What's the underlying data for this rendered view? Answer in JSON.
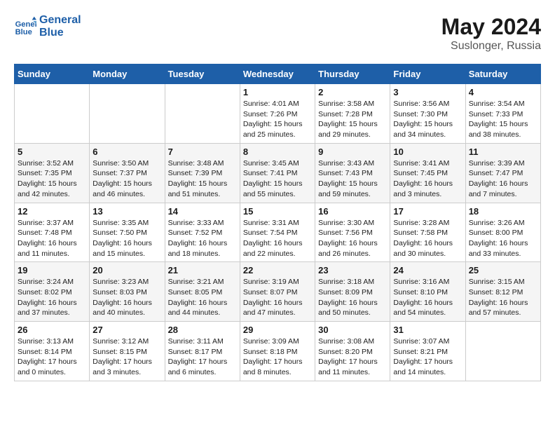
{
  "header": {
    "logo_line1": "General",
    "logo_line2": "Blue",
    "month": "May 2024",
    "location": "Suslonger, Russia"
  },
  "days_of_week": [
    "Sunday",
    "Monday",
    "Tuesday",
    "Wednesday",
    "Thursday",
    "Friday",
    "Saturday"
  ],
  "weeks": [
    [
      {
        "day": "",
        "info": ""
      },
      {
        "day": "",
        "info": ""
      },
      {
        "day": "",
        "info": ""
      },
      {
        "day": "1",
        "info": "Sunrise: 4:01 AM\nSunset: 7:26 PM\nDaylight: 15 hours\nand 25 minutes."
      },
      {
        "day": "2",
        "info": "Sunrise: 3:58 AM\nSunset: 7:28 PM\nDaylight: 15 hours\nand 29 minutes."
      },
      {
        "day": "3",
        "info": "Sunrise: 3:56 AM\nSunset: 7:30 PM\nDaylight: 15 hours\nand 34 minutes."
      },
      {
        "day": "4",
        "info": "Sunrise: 3:54 AM\nSunset: 7:33 PM\nDaylight: 15 hours\nand 38 minutes."
      }
    ],
    [
      {
        "day": "5",
        "info": "Sunrise: 3:52 AM\nSunset: 7:35 PM\nDaylight: 15 hours\nand 42 minutes."
      },
      {
        "day": "6",
        "info": "Sunrise: 3:50 AM\nSunset: 7:37 PM\nDaylight: 15 hours\nand 46 minutes."
      },
      {
        "day": "7",
        "info": "Sunrise: 3:48 AM\nSunset: 7:39 PM\nDaylight: 15 hours\nand 51 minutes."
      },
      {
        "day": "8",
        "info": "Sunrise: 3:45 AM\nSunset: 7:41 PM\nDaylight: 15 hours\nand 55 minutes."
      },
      {
        "day": "9",
        "info": "Sunrise: 3:43 AM\nSunset: 7:43 PM\nDaylight: 15 hours\nand 59 minutes."
      },
      {
        "day": "10",
        "info": "Sunrise: 3:41 AM\nSunset: 7:45 PM\nDaylight: 16 hours\nand 3 minutes."
      },
      {
        "day": "11",
        "info": "Sunrise: 3:39 AM\nSunset: 7:47 PM\nDaylight: 16 hours\nand 7 minutes."
      }
    ],
    [
      {
        "day": "12",
        "info": "Sunrise: 3:37 AM\nSunset: 7:48 PM\nDaylight: 16 hours\nand 11 minutes."
      },
      {
        "day": "13",
        "info": "Sunrise: 3:35 AM\nSunset: 7:50 PM\nDaylight: 16 hours\nand 15 minutes."
      },
      {
        "day": "14",
        "info": "Sunrise: 3:33 AM\nSunset: 7:52 PM\nDaylight: 16 hours\nand 18 minutes."
      },
      {
        "day": "15",
        "info": "Sunrise: 3:31 AM\nSunset: 7:54 PM\nDaylight: 16 hours\nand 22 minutes."
      },
      {
        "day": "16",
        "info": "Sunrise: 3:30 AM\nSunset: 7:56 PM\nDaylight: 16 hours\nand 26 minutes."
      },
      {
        "day": "17",
        "info": "Sunrise: 3:28 AM\nSunset: 7:58 PM\nDaylight: 16 hours\nand 30 minutes."
      },
      {
        "day": "18",
        "info": "Sunrise: 3:26 AM\nSunset: 8:00 PM\nDaylight: 16 hours\nand 33 minutes."
      }
    ],
    [
      {
        "day": "19",
        "info": "Sunrise: 3:24 AM\nSunset: 8:02 PM\nDaylight: 16 hours\nand 37 minutes."
      },
      {
        "day": "20",
        "info": "Sunrise: 3:23 AM\nSunset: 8:03 PM\nDaylight: 16 hours\nand 40 minutes."
      },
      {
        "day": "21",
        "info": "Sunrise: 3:21 AM\nSunset: 8:05 PM\nDaylight: 16 hours\nand 44 minutes."
      },
      {
        "day": "22",
        "info": "Sunrise: 3:19 AM\nSunset: 8:07 PM\nDaylight: 16 hours\nand 47 minutes."
      },
      {
        "day": "23",
        "info": "Sunrise: 3:18 AM\nSunset: 8:09 PM\nDaylight: 16 hours\nand 50 minutes."
      },
      {
        "day": "24",
        "info": "Sunrise: 3:16 AM\nSunset: 8:10 PM\nDaylight: 16 hours\nand 54 minutes."
      },
      {
        "day": "25",
        "info": "Sunrise: 3:15 AM\nSunset: 8:12 PM\nDaylight: 16 hours\nand 57 minutes."
      }
    ],
    [
      {
        "day": "26",
        "info": "Sunrise: 3:13 AM\nSunset: 8:14 PM\nDaylight: 17 hours\nand 0 minutes."
      },
      {
        "day": "27",
        "info": "Sunrise: 3:12 AM\nSunset: 8:15 PM\nDaylight: 17 hours\nand 3 minutes."
      },
      {
        "day": "28",
        "info": "Sunrise: 3:11 AM\nSunset: 8:17 PM\nDaylight: 17 hours\nand 6 minutes."
      },
      {
        "day": "29",
        "info": "Sunrise: 3:09 AM\nSunset: 8:18 PM\nDaylight: 17 hours\nand 8 minutes."
      },
      {
        "day": "30",
        "info": "Sunrise: 3:08 AM\nSunset: 8:20 PM\nDaylight: 17 hours\nand 11 minutes."
      },
      {
        "day": "31",
        "info": "Sunrise: 3:07 AM\nSunset: 8:21 PM\nDaylight: 17 hours\nand 14 minutes."
      },
      {
        "day": "",
        "info": ""
      }
    ]
  ]
}
